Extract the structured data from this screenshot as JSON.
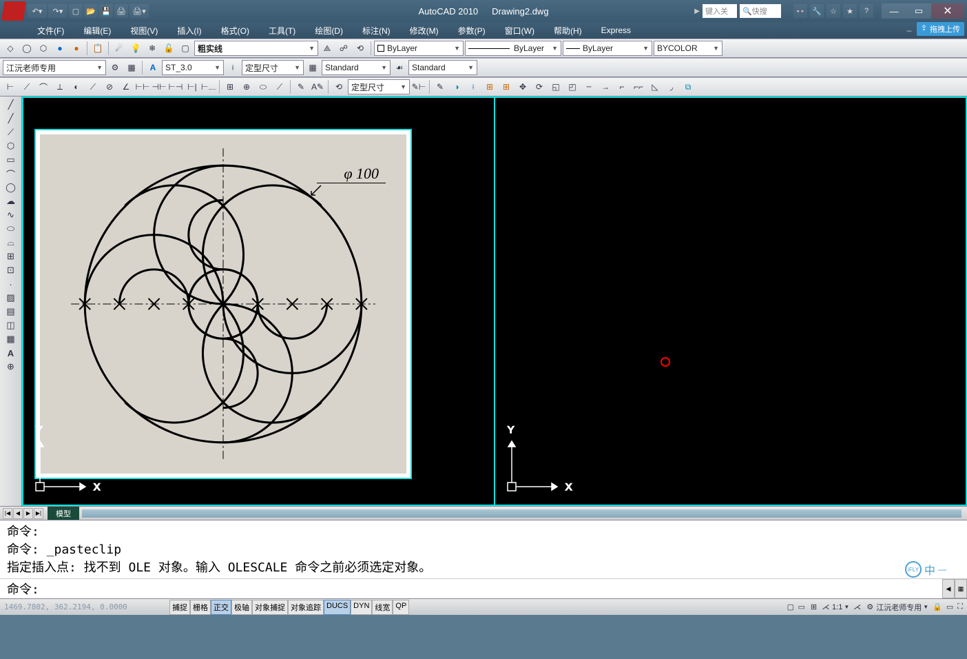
{
  "titlebar": {
    "app_name": "AutoCAD 2010",
    "filename": "Drawing2.dwg",
    "keyword_placeholder": "键入关",
    "search_placeholder": "快搜",
    "drag_upload": "拖拽上传"
  },
  "menu": {
    "items": [
      "文件(F)",
      "编辑(E)",
      "视图(V)",
      "插入(I)",
      "格式(O)",
      "工具(T)",
      "绘图(D)",
      "标注(N)",
      "修改(M)",
      "参数(P)",
      "窗口(W)",
      "帮助(H)",
      "Express"
    ]
  },
  "toolbars": {
    "layer_name": "江沅老师专用",
    "linetype_style": "粗实线",
    "layer_selector": "ByLayer",
    "linetype_selector": "ByLayer",
    "lineweight_selector": "ByLayer",
    "color_selector": "BYCOLOR",
    "text_style": "ST_3.0",
    "dim_style1": "定型尺寸",
    "dim_style2": "Standard",
    "dim_style3": "Standard",
    "dim_style4": "定型尺寸"
  },
  "viewport": {
    "dimension_label": "φ 100"
  },
  "tabs": {
    "model": "模型"
  },
  "command": {
    "line1": "命令:",
    "line2": "命令: _pasteclip",
    "line3": "指定插入点: 找不到 OLE 对象。输入 OLESCALE 命令之前必须选定对象。",
    "prompt": "命令:"
  },
  "status": {
    "coords": "1469.7802, 362.2194, 0.0000",
    "snaps": [
      {
        "label": "捕捉",
        "on": false
      },
      {
        "label": "栅格",
        "on": false
      },
      {
        "label": "正交",
        "on": true
      },
      {
        "label": "极轴",
        "on": false
      },
      {
        "label": "对象捕捉",
        "on": false
      },
      {
        "label": "对象追踪",
        "on": false
      },
      {
        "label": "DUCS",
        "on": true
      },
      {
        "label": "DYN",
        "on": false
      },
      {
        "label": "线宽",
        "on": false
      },
      {
        "label": "QP",
        "on": false
      }
    ],
    "scale": "1:1",
    "annotation": "江沅老师专用"
  },
  "ifly": {
    "logo": "iFLY",
    "lang": "中"
  }
}
